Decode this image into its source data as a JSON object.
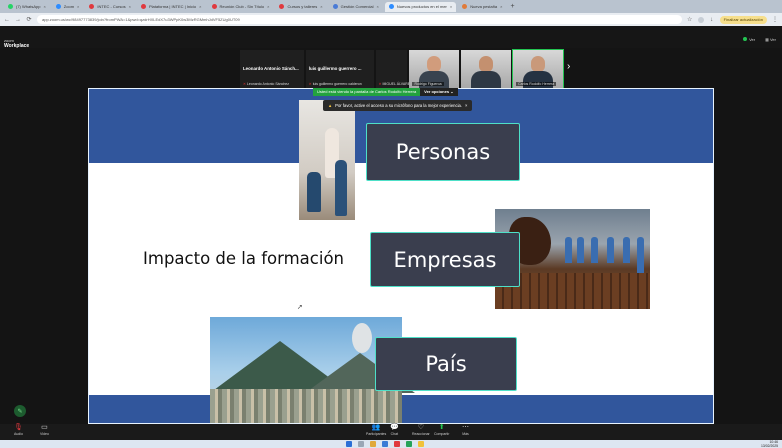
{
  "browser": {
    "tabs": [
      {
        "label": "(7) WhatsApp",
        "color": "#25d366"
      },
      {
        "label": "Zoom",
        "color": "#2d8cff"
      },
      {
        "label": "INTEC - Cursos",
        "color": "#e0393e"
      },
      {
        "label": "Plataforma | INTEC | Inicio",
        "color": "#e0393e"
      },
      {
        "label": "Reunión Club - Sin Título",
        "color": "#e0393e"
      },
      {
        "label": "Cursos y talleres",
        "color": "#e0393e"
      },
      {
        "label": "Gestión Comercial",
        "color": "#4a7bd6"
      },
      {
        "label": "Nuevos productos en el mer",
        "color": "#2d8cff"
      },
      {
        "label": "Nueva pestaña",
        "color": "#e07b3a"
      }
    ],
    "url": "app.zoom.us/wc/98497773839/join?fromPWA=1&pwd=qzdrHXLEdX7u3WPpK0w3MzRGMmhJdVF5ZUg0UT09",
    "profile_label": "Finalizar actualización"
  },
  "zoom": {
    "brand_small": "zoom",
    "brand_big": "Workplace",
    "right_items": [
      "Ver",
      "Ver"
    ],
    "participants": [
      {
        "name": "Leonardo Antonio Sánch...",
        "sub": "Leonardo Antonio Sánchez",
        "video": false
      },
      {
        "name": "luis guillermo guerrero ...",
        "sub": "luis guillermo guerrero calderon",
        "video": false
      },
      {
        "name": "",
        "sub": "MIGUEL ÁLVAREZ",
        "video": true
      },
      {
        "name": "",
        "sub": "Rodrigo Figueroa",
        "video": true
      },
      {
        "name": "",
        "sub": "Carlos Rodolfo Herrera",
        "video": true
      }
    ],
    "share_banner": "Usted está viendo la pantalla de Carlos Rodolfo Herrera",
    "view_options": "Ver opciones",
    "toolbar": [
      {
        "label": "Audio",
        "icon": "mic-icon"
      },
      {
        "label": "Video",
        "icon": "video-icon"
      },
      {
        "label": "Participantes",
        "icon": "participants-icon"
      },
      {
        "label": "Chat",
        "icon": "chat-icon"
      },
      {
        "label": "Reaccionar",
        "icon": "react-icon"
      },
      {
        "label": "Compartir",
        "icon": "share-icon"
      },
      {
        "label": "Más",
        "icon": "more-icon"
      }
    ]
  },
  "slide": {
    "notice": "Por favor, active el acceso a su micrófono para la mejor experiencia.",
    "notice_link": "micrófono",
    "title": "Impacto de la formación",
    "labels": [
      "Personas",
      "Empresas",
      "País"
    ]
  },
  "taskbar": {
    "time": "10:46",
    "date": "13/02/2025"
  }
}
